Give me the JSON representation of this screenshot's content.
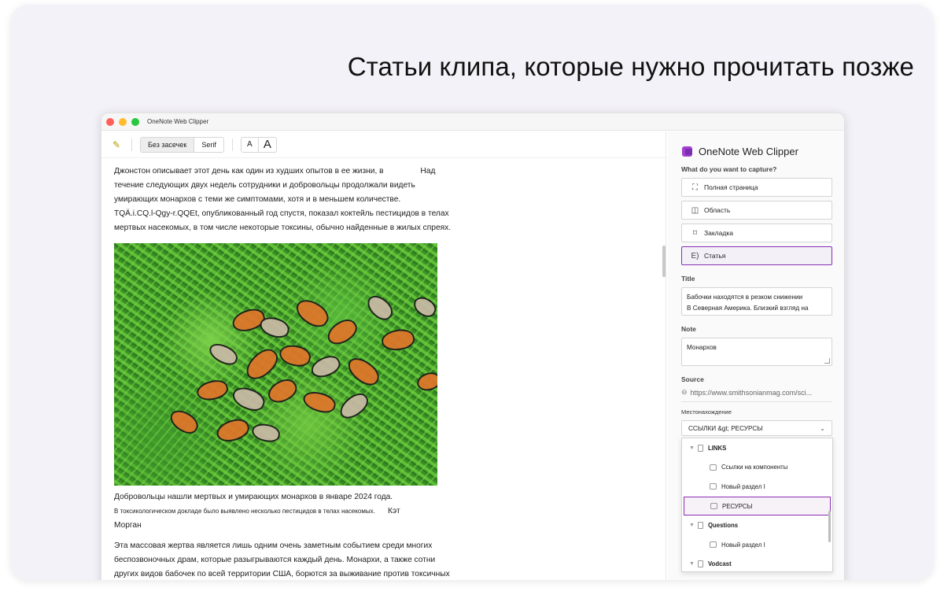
{
  "headline": "Статьи клипа, которые нужно прочитать позже",
  "window": {
    "title": "OneNote Web Clipper"
  },
  "toolbar": {
    "pen_icon": "highlighter-icon",
    "fonts": [
      "Без засечек",
      "Serif"
    ],
    "size_small": "A",
    "size_large": "A"
  },
  "article": {
    "para1_lines": [
      "Джонстон описывает этот день как один из худших опытов в ее жизни, в",
      "течение следующих двух недель сотрудники и добровольцы продолжали видеть",
      "умирающих монархов с теми же симптомами, хотя и в меньшем количестве.",
      "TQÄ.i.CQ.l-Qgy-r.QQEt, опубликованный год спустя, показал коктейль пестицидов в телах",
      "мертвых насекомых, в том числе некоторые токсины, обычно найденные в жилых спреях."
    ],
    "para1_aside": "Над",
    "image_alt": "monarch-butterflies-photo",
    "caption_line1": "Добровольцы нашли мертвых и умирающих монархов в январе 2024 года.",
    "caption_line2": "В токсикологическом докладе было выявлено несколько пестицидов в телах насекомых.",
    "caption_author_first": "Кэт",
    "caption_author_last": "Морган",
    "para2_lines": [
      "Эта массовая жертва является лишь одним очень заметным событием среди многих",
      "беспозвоночных драм, которые разыгрываются каждый день. Монархи, а также сотни",
      "других видов бабочек по всей территории США, борются за выживание против токсичных"
    ]
  },
  "clipper": {
    "brand": "OneNote Web Clipper",
    "capture_label": "What do you want to capture?",
    "options": [
      {
        "icon": "full-page-icon",
        "glyph": "⛶",
        "label": "Полная страница",
        "selected": false
      },
      {
        "icon": "region-icon",
        "glyph": "◫",
        "label": "Область",
        "selected": false
      },
      {
        "icon": "bookmark-icon",
        "glyph": "⌑",
        "label": "Закладка",
        "selected": false
      },
      {
        "icon": "article-icon",
        "glyph": "E)",
        "label": "Статья",
        "selected": true
      }
    ],
    "title_label": "Title",
    "title_value_line1": "Бабочки находятся в резком снижении",
    "title_value_line2": "В Северная Америка. Близкий взгляд на",
    "note_label": "Note",
    "note_value": "Монархов",
    "source_label": "Source",
    "source_value": "https://www.smithsonianmag.com/sci...",
    "location_label": "Местонахождение",
    "location_value": "ССЫЛКИ &gt; РЕСУРСЫ",
    "tree": [
      {
        "type": "notebook",
        "label": "LINKS"
      },
      {
        "type": "section",
        "label": "Ссылки на компоненты"
      },
      {
        "type": "section",
        "label": "Новый раздел I"
      },
      {
        "type": "section",
        "label": "РЕСУРСЫ",
        "selected": true
      },
      {
        "type": "notebook",
        "label": "Questions"
      },
      {
        "type": "section",
        "label": "Новый раздел I"
      },
      {
        "type": "notebook",
        "label": "Vodcast"
      }
    ]
  }
}
